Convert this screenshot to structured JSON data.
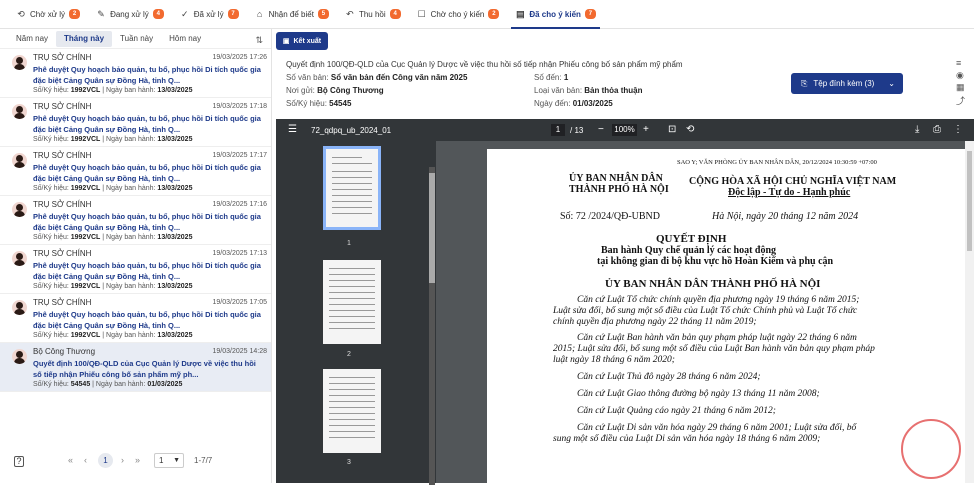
{
  "tabs": [
    {
      "icon": "⟲",
      "label": "Chờ xử lý",
      "badge": "2"
    },
    {
      "icon": "✎",
      "label": "Đang xử lý",
      "badge": "4"
    },
    {
      "icon": "✓",
      "label": "Đã xử lý",
      "badge": "7"
    },
    {
      "icon": "⌂",
      "label": "Nhận để biết",
      "badge": "5"
    },
    {
      "icon": "↶",
      "label": "Thu hồi",
      "badge": "4"
    },
    {
      "icon": "☐",
      "label": "Chờ cho ý kiến",
      "badge": "2"
    },
    {
      "icon": "▤",
      "label": "Đã cho ý kiến",
      "badge": "7"
    }
  ],
  "filters": [
    "Năm nay",
    "Tháng này",
    "Tuần này",
    "Hôm nay"
  ],
  "items": [
    {
      "org": "TRỤ SỞ CHÍNH",
      "date": "19/03/2025 17:26",
      "title": "Phê duyệt Quy hoạch bảo quản, tu bổ, phục hồi Di tích quốc gia đặc biệt Cảng Quân sự Đồng Hà, tỉnh Q...",
      "label_no": "Số/Ký hiệu: ",
      "no": "1992VCL",
      "label_date": " | Ngày ban hành: ",
      "issued": "13/03/2025"
    },
    {
      "org": "TRỤ SỞ CHÍNH",
      "date": "19/03/2025 17:18",
      "title": "Phê duyệt Quy hoạch bảo quản, tu bổ, phục hồi Di tích quốc gia đặc biệt Cảng Quân sự Đồng Hà, tỉnh Q...",
      "label_no": "Số/Ký hiệu: ",
      "no": "1992VCL",
      "label_date": " | Ngày ban hành: ",
      "issued": "13/03/2025"
    },
    {
      "org": "TRỤ SỞ CHÍNH",
      "date": "19/03/2025 17:17",
      "title": "Phê duyệt Quy hoạch bảo quản, tu bổ, phục hồi Di tích quốc gia đặc biệt Cảng Quân sự Đồng Hà, tỉnh Q...",
      "label_no": "Số/Ký hiệu: ",
      "no": "1992VCL",
      "label_date": " | Ngày ban hành: ",
      "issued": "13/03/2025"
    },
    {
      "org": "TRỤ SỞ CHÍNH",
      "date": "19/03/2025 17:16",
      "title": "Phê duyệt Quy hoạch bảo quản, tu bổ, phục hồi Di tích quốc gia đặc biệt Cảng Quân sự Đồng Hà, tỉnh Q...",
      "label_no": "Số/Ký hiệu: ",
      "no": "1992VCL",
      "label_date": " | Ngày ban hành: ",
      "issued": "13/03/2025"
    },
    {
      "org": "TRỤ SỞ CHÍNH",
      "date": "19/03/2025 17:13",
      "title": "Phê duyệt Quy hoạch bảo quản, tu bổ, phục hồi Di tích quốc gia đặc biệt Cảng Quân sự Đồng Hà, tỉnh Q...",
      "label_no": "Số/Ký hiệu: ",
      "no": "1992VCL",
      "label_date": " | Ngày ban hành: ",
      "issued": "13/03/2025"
    },
    {
      "org": "TRỤ SỞ CHÍNH",
      "date": "19/03/2025 17:05",
      "title": "Phê duyệt Quy hoạch bảo quản, tu bổ, phục hồi Di tích quốc gia đặc biệt Cảng Quân sự Đồng Hà, tỉnh Q...",
      "label_no": "Số/Ký hiệu: ",
      "no": "1992VCL",
      "label_date": " | Ngày ban hành: ",
      "issued": "13/03/2025"
    },
    {
      "org": "Bộ Công Thương",
      "date": "19/03/2025 14:28",
      "title": "Quyết định 100/QĐ-QLD của Cục Quản lý Dược về việc thu hồi số tiếp nhận Phiếu công bố sản phẩm mỹ ph...",
      "label_no": "Số/Ký hiệu: ",
      "no": "54545",
      "label_date": " | Ngày ban hành: ",
      "issued": "01/03/2025"
    }
  ],
  "pager": {
    "current": "1",
    "per_page": "1",
    "range": "1-7/7"
  },
  "toolbar": {
    "export_label": "Kết xuất"
  },
  "detail": {
    "title": "Quyết định 100/QĐ-QLD của Cục Quản lý Dược về việc thu hồi số tiếp nhận Phiếu công bố sản phẩm mỹ phẩm",
    "book_label": "Số văn bản: ",
    "book": "Sổ văn bản đến Công văn năm 2025",
    "arrival_label": "Số đến: ",
    "arrival": "1",
    "sender_label": "Nơi gửi: ",
    "sender": "Bộ Công Thương",
    "type_label": "Loại văn bản: ",
    "type": "Bản thỏa thuận",
    "no_label": "Số/Ký hiệu: ",
    "no": "54545",
    "date_label": "Ngày đến: ",
    "date": "01/03/2025",
    "attach_label": "Tệp đính kèm (3)"
  },
  "viewer": {
    "file": "72_qdpq_ub_2024_01",
    "page": "1",
    "total": "/ 13",
    "zoom": "100%",
    "thumb_nums": [
      "1",
      "2",
      "3"
    ]
  },
  "doc": {
    "copy": "SAO Y; VĂN PHÒNG ỦY BAN NHÂN DÂN, 20/12/2024 10:30:59 +07:00",
    "org1": "ỦY BAN NHÂN DÂN",
    "org2": "THÀNH PHỐ HÀ NỘI",
    "nation": "CỘNG HÒA XÃ HỘI CHỦ NGHĨA VIỆT NAM",
    "motto": "Độc lập - Tự do - Hạnh phúc",
    "number": "Số:  72  /2024/QĐ-UBND",
    "place_date": "Hà Nội, ngày  20  tháng 12 năm 2024",
    "heading": "QUYẾT ĐỊNH",
    "sub1": "Ban hành Quy chế quản lý các hoạt động",
    "sub2": "tại không gian đi bộ khu vực hồ Hoàn Kiếm và phụ cận",
    "authority": "ỦY BAN NHÂN DÂN THÀNH PHỐ HÀ NỘI",
    "lines": [
      "Căn cứ Luật Tổ chức chính quyền địa phương ngày 19 tháng 6 năm 2015;",
      "Luật sửa đổi, bổ sung một số điều của Luật Tổ chức Chính phủ và Luật Tổ chức",
      "chính quyền địa phương ngày 22 tháng 11 năm 2019;",
      "Căn cứ Luật Ban hành văn bản quy phạm pháp luật ngày 22 tháng 6 năm",
      "2015; Luật sửa đổi, bổ sung một số điều của Luật Ban hành văn bản quy phạm pháp",
      "luật ngày 18 tháng 6 năm 2020;",
      "Căn cứ Luật Thủ đô ngày 28 tháng 6 năm 2024;",
      "Căn cứ Luật Giao thông đường bộ ngày 13 tháng 11 năm 2008;",
      "Căn cứ Luật Quảng cáo ngày 21 tháng 6 năm 2012;",
      "Căn cứ Luật Di sản văn hóa ngày 29 tháng 6 năm 2001; Luật sửa đổi, bổ",
      "sung một số điều của Luật Di sản văn hóa ngày 18 tháng 6 năm 2009;"
    ]
  }
}
